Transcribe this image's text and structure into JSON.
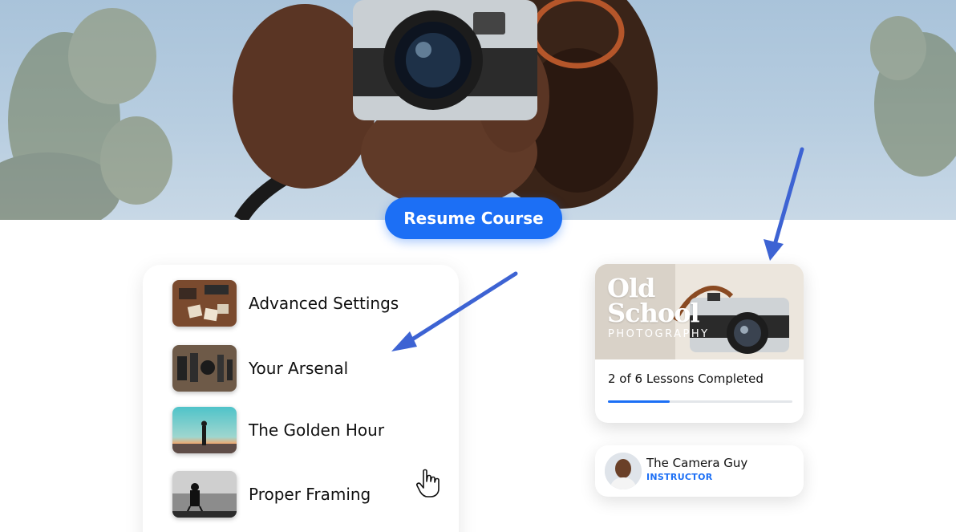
{
  "hero": {
    "resume_label": "Resume Course"
  },
  "lessons": [
    {
      "title": "Advanced Settings"
    },
    {
      "title": "Your Arsenal"
    },
    {
      "title": "The Golden Hour"
    },
    {
      "title": "Proper Framing"
    }
  ],
  "course": {
    "cover_title_line1": "Old",
    "cover_title_line2": "School",
    "cover_subtitle": "PHOTOGRAPHY",
    "progress_text": "2 of 6 Lessons Completed",
    "lessons_completed": 2,
    "lessons_total": 6,
    "accent_color": "#1c6ff5"
  },
  "instructor": {
    "name": "The Camera Guy",
    "role": "INSTRUCTOR"
  },
  "icons": {
    "cursor": "hand-pointer-icon",
    "arrow": "annotation-arrow-icon"
  }
}
